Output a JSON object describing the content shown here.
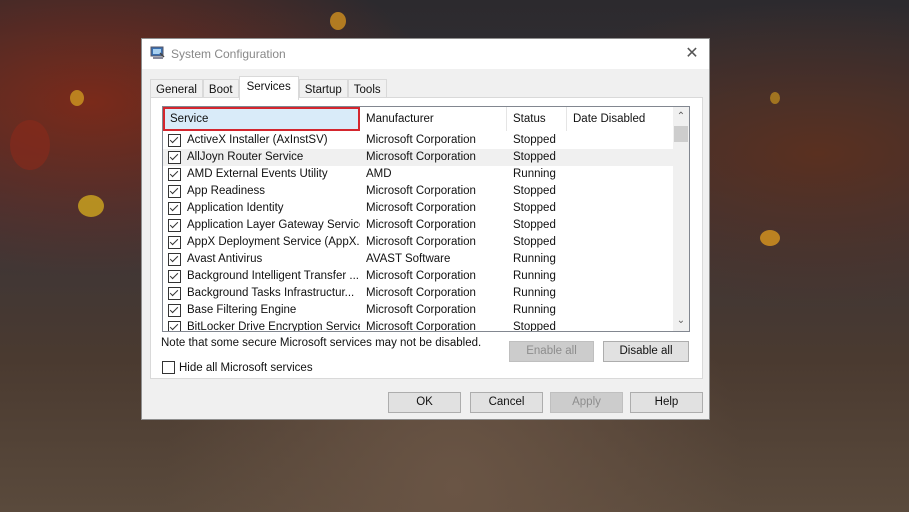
{
  "window": {
    "title": "System Configuration",
    "close_label": "✕"
  },
  "tabs": [
    {
      "label": "General",
      "active": false
    },
    {
      "label": "Boot",
      "active": false
    },
    {
      "label": "Services",
      "active": true
    },
    {
      "label": "Startup",
      "active": false
    },
    {
      "label": "Tools",
      "active": false
    }
  ],
  "services": {
    "columns": [
      "Service",
      "Manufacturer",
      "Status",
      "Date Disabled"
    ],
    "highlight_color": "#d4262e",
    "rows": [
      {
        "checked": true,
        "service": "ActiveX Installer (AxInstSV)",
        "manufacturer": "Microsoft Corporation",
        "status": "Stopped",
        "date_disabled": ""
      },
      {
        "checked": true,
        "service": "AllJoyn Router Service",
        "manufacturer": "Microsoft Corporation",
        "status": "Stopped",
        "date_disabled": ""
      },
      {
        "checked": true,
        "service": "AMD External Events Utility",
        "manufacturer": "AMD",
        "status": "Running",
        "date_disabled": ""
      },
      {
        "checked": true,
        "service": "App Readiness",
        "manufacturer": "Microsoft Corporation",
        "status": "Stopped",
        "date_disabled": ""
      },
      {
        "checked": true,
        "service": "Application Identity",
        "manufacturer": "Microsoft Corporation",
        "status": "Stopped",
        "date_disabled": ""
      },
      {
        "checked": true,
        "service": "Application Layer Gateway Service",
        "manufacturer": "Microsoft Corporation",
        "status": "Stopped",
        "date_disabled": ""
      },
      {
        "checked": true,
        "service": "AppX Deployment Service (AppX...",
        "manufacturer": "Microsoft Corporation",
        "status": "Stopped",
        "date_disabled": ""
      },
      {
        "checked": true,
        "service": "Avast Antivirus",
        "manufacturer": "AVAST Software",
        "status": "Running",
        "date_disabled": ""
      },
      {
        "checked": true,
        "service": "Background Intelligent Transfer ...",
        "manufacturer": "Microsoft Corporation",
        "status": "Running",
        "date_disabled": ""
      },
      {
        "checked": true,
        "service": "Background Tasks Infrastructur...",
        "manufacturer": "Microsoft Corporation",
        "status": "Running",
        "date_disabled": ""
      },
      {
        "checked": true,
        "service": "Base Filtering Engine",
        "manufacturer": "Microsoft Corporation",
        "status": "Running",
        "date_disabled": ""
      },
      {
        "checked": true,
        "service": "BitLocker Drive Encryption Service",
        "manufacturer": "Microsoft Corporation",
        "status": "Stopped",
        "date_disabled": ""
      }
    ],
    "scroll_up_icon": "⌃",
    "scroll_down_icon": "⌄"
  },
  "note": "Note that some secure Microsoft services may not be disabled.",
  "enable_all_label": "Enable all",
  "disable_all_label": "Disable all",
  "hide_ms_label": "Hide all Microsoft services",
  "hide_ms_checked": false,
  "footer": {
    "ok_label": "OK",
    "cancel_label": "Cancel",
    "apply_label": "Apply",
    "help_label": "Help"
  }
}
